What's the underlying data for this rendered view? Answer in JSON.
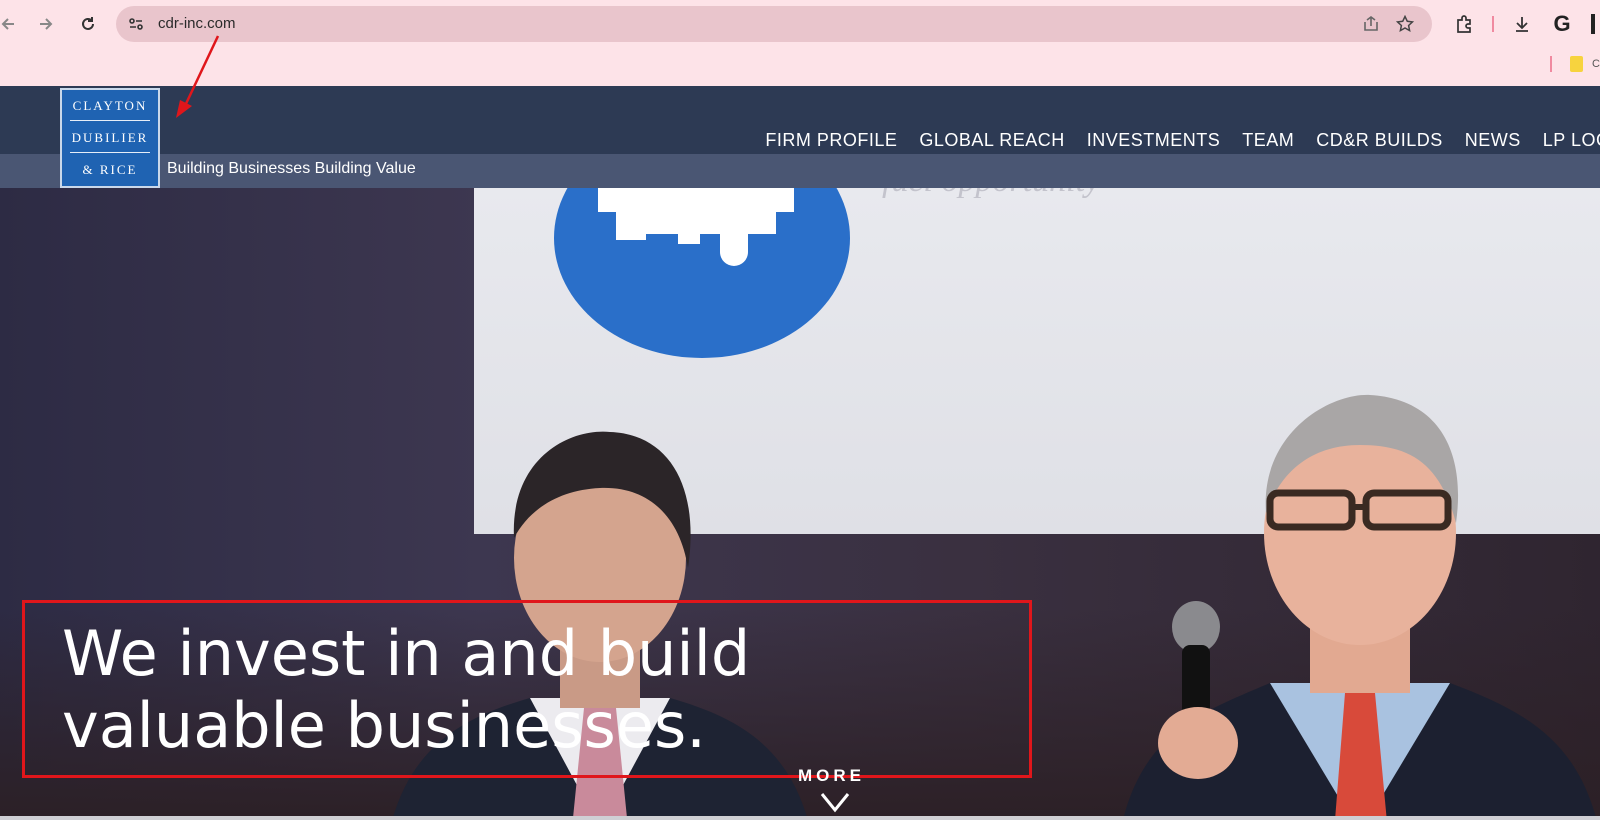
{
  "browser": {
    "url": "cdr-inc.com",
    "google_letter": "G",
    "bookmark_cut": "C"
  },
  "site": {
    "logo": {
      "line1": "CLAYTON",
      "line2": "DUBILIER",
      "line3": "& RICE"
    },
    "tagline": "Building Businesses Building Value",
    "nav": [
      "FIRM PROFILE",
      "GLOBAL REACH",
      "INVESTMENTS",
      "TEAM",
      "CD&R BUILDS",
      "NEWS",
      "LP LOG-IN"
    ]
  },
  "hero": {
    "headline": "We invest in and build valuable businesses.",
    "more": "MORE",
    "screen_text": "fuel opportunity"
  },
  "colors": {
    "header": "#2d3a54",
    "logo_blue": "#1f63b2",
    "annotation_red": "#e0161b"
  }
}
